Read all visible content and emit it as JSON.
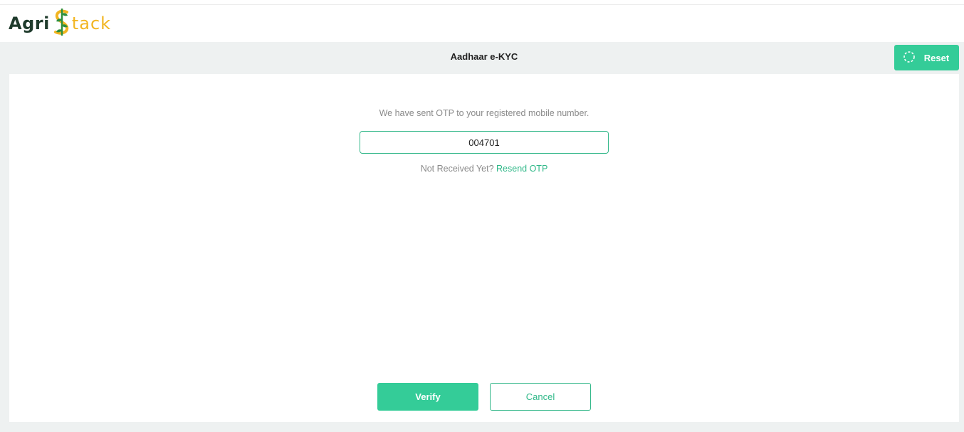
{
  "header": {
    "logo": {
      "part1": "Agri",
      "part2": "tack"
    }
  },
  "page": {
    "title": "Aadhaar e-KYC",
    "reset_label": "Reset"
  },
  "otp": {
    "message": "We have sent OTP to your registered mobile number.",
    "value": "004701",
    "not_received": "Not Received Yet?",
    "resend_label": "Resend OTP"
  },
  "actions": {
    "verify_label": "Verify",
    "cancel_label": "Cancel"
  },
  "colors": {
    "accent": "#34cc98",
    "logo_dark": "#1f3b2c",
    "logo_yellow": "#f2b521",
    "band": "#eef1f1"
  }
}
